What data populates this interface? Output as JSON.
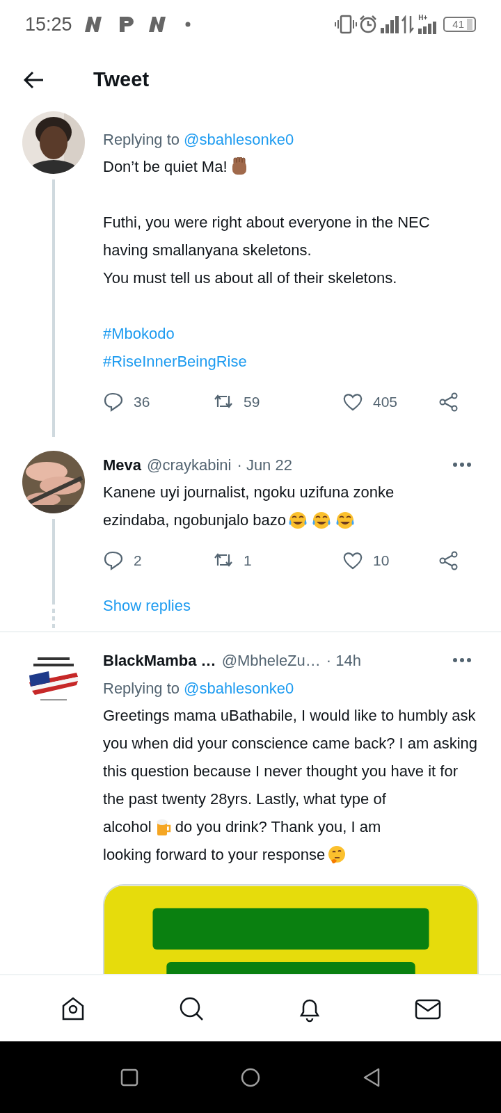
{
  "status_bar": {
    "time": "15:25",
    "network_label": "H+",
    "battery": "41"
  },
  "header": {
    "title": "Tweet"
  },
  "tweets": [
    {
      "avatar": {
        "kind": "person"
      },
      "replying_label": "Replying to",
      "replying_to": "@sbahlesonke0",
      "thread": {
        "kind": "solid"
      },
      "body": [
        [
          [
            {
              "kind": "text",
              "text": "Don’t be quiet Ma!"
            },
            {
              "kind": "fist"
            }
          ]
        ],
        [
          [
            {
              "kind": "text",
              "text": "Futhi, you were right about everyone in the NEC having smallanyana skeletons."
            }
          ],
          [
            {
              "kind": "text",
              "text": "You must tell us about all of their skeletons."
            }
          ]
        ],
        [
          [
            {
              "kind": "hashtag",
              "text": "#Mbokodo"
            }
          ],
          [
            {
              "kind": "hashtag",
              "text": "#RiseInnerBeingRise"
            }
          ]
        ]
      ],
      "replies": "36",
      "retweets": "59",
      "likes": "405"
    },
    {
      "avatar": {
        "kind": "picture"
      },
      "name": "Meva",
      "handle": "@craykabini",
      "time": "· Jun 22",
      "thread": {
        "kind": "dotted"
      },
      "body": [
        [
          [
            {
              "kind": "text",
              "text": "Kanene uyi journalist, ngoku uzifuna zonke"
            }
          ],
          [
            {
              "kind": "text",
              "text": "ezindaba, ngobunjalo bazo"
            },
            {
              "kind": "laugh"
            },
            {
              "kind": "laugh"
            },
            {
              "kind": "laugh"
            }
          ]
        ]
      ],
      "replies": "2",
      "retweets": "1",
      "likes": "10",
      "show_replies": "Show replies"
    },
    {
      "avatar": {
        "kind": "logo"
      },
      "name": "BlackMamba …",
      "handle": "@MbheleZu…",
      "time": "· 14h",
      "replying_label": "Replying to",
      "replying_to": "@sbahlesonke0",
      "body": [
        [
          [
            {
              "kind": "text",
              "text": "Greetings mama uBathabile, I would like to humbly ask you when did your conscience came back? I am asking this question because I never thought you have it for the past twenty 28yrs. Lastly, what type of"
            }
          ],
          [
            {
              "kind": "text",
              "text": "alcohol"
            },
            {
              "kind": "beer"
            },
            {
              "kind": "text",
              "text": "do you drink? Thank you, I am"
            }
          ],
          [
            {
              "kind": "text",
              "text": "looking forward to your response"
            },
            {
              "kind": "thinking"
            }
          ]
        ]
      ],
      "media": {
        "kind": "picture"
      }
    }
  ]
}
